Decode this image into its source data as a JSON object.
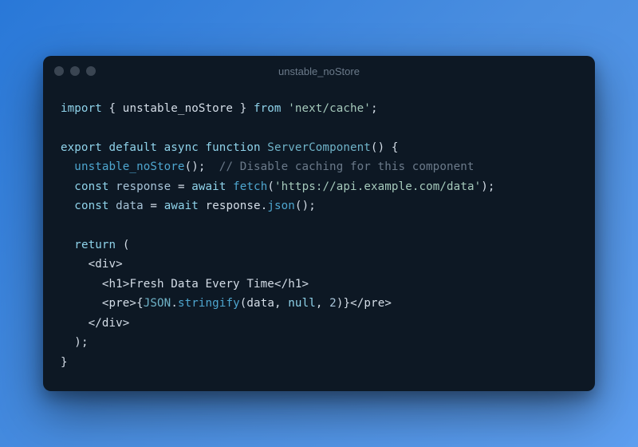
{
  "window": {
    "title": "unstable_noStore"
  },
  "code": {
    "line1": {
      "import": "import",
      "lbrace": " { ",
      "identifier": "unstable_noStore",
      "rbrace": " } ",
      "from": "from",
      "space": " ",
      "module": "'next/cache'",
      "semi": ";"
    },
    "line3": {
      "export": "export",
      "default": " default",
      "async": " async",
      "function": " function",
      "space": " ",
      "name": "ServerComponent",
      "parens": "()",
      "space2": " ",
      "lbrace": "{"
    },
    "line4": {
      "indent": "  ",
      "call": "unstable_noStore",
      "parens": "();",
      "space": "  ",
      "comment": "// Disable caching for this component"
    },
    "line5": {
      "indent": "  ",
      "const": "const",
      "space": " ",
      "varname": "response",
      "eq": " = ",
      "await": "await",
      "space2": " ",
      "fetch": "fetch",
      "lparen": "(",
      "url": "'https://api.example.com/data'",
      "rparen": ");"
    },
    "line6": {
      "indent": "  ",
      "const": "const",
      "space": " ",
      "varname": "data",
      "eq": " = ",
      "await": "await",
      "space2": " ",
      "obj": "response.",
      "method": "json",
      "parens": "();"
    },
    "line8": {
      "indent": "  ",
      "return": "return",
      "space": " ",
      "lparen": "("
    },
    "line9": {
      "indent": "    ",
      "tag": "<div>"
    },
    "line10": {
      "indent": "      ",
      "open": "<h1>",
      "text": "Fresh Data Every Time",
      "close": "</h1>"
    },
    "line11": {
      "indent": "      ",
      "open": "<pre>",
      "lbrace": "{",
      "json": "JSON",
      "dot": ".",
      "stringify": "stringify",
      "lparen": "(",
      "arg1": "data",
      "comma1": ", ",
      "arg2": "null",
      "comma2": ", ",
      "arg3": "2",
      "rparen": ")",
      "rbrace": "}",
      "close": "</pre>"
    },
    "line12": {
      "indent": "    ",
      "tag": "</div>"
    },
    "line13": {
      "indent": "  ",
      "rparen": ");"
    },
    "line14": {
      "rbrace": "}"
    }
  }
}
